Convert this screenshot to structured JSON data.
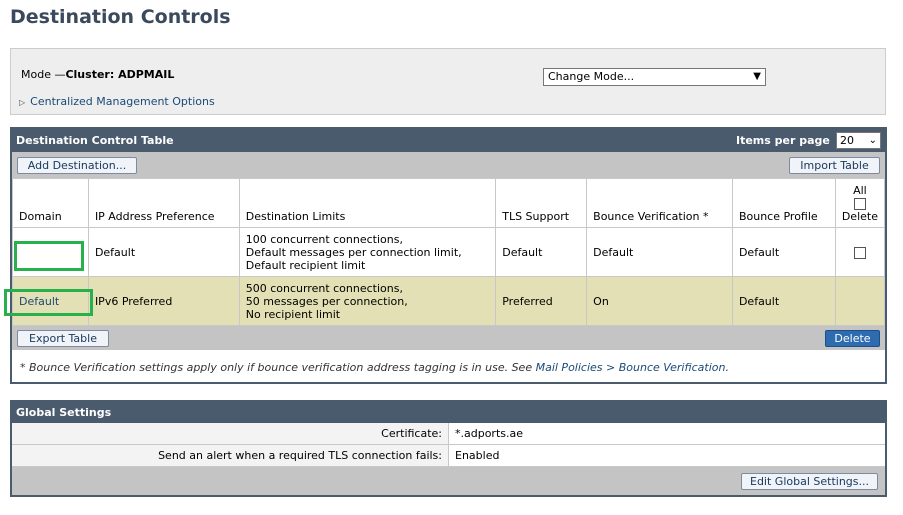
{
  "page": {
    "title": "Destination Controls"
  },
  "mode": {
    "prefix": "Mode —",
    "cluster": "Cluster: ADPMAIL",
    "select_value": "Change Mode...",
    "cm_options": "Centralized Management Options"
  },
  "dct": {
    "title": "Destination Control Table",
    "items_per_page_label": "Items per page",
    "items_per_page_value": "20",
    "add_button": "Add Destination...",
    "import_button": "Import Table",
    "export_button": "Export Table",
    "delete_button": "Delete",
    "columns": {
      "domain": "Domain",
      "ip_pref": "IP Address Preference",
      "limits": "Destination Limits",
      "tls": "TLS Support",
      "bounce_verif": "Bounce Verification *",
      "bounce_profile": "Bounce Profile",
      "delete_all": "All",
      "delete": "Delete"
    },
    "rows": [
      {
        "domain": "",
        "ip_pref": "Default",
        "limits": [
          "100 concurrent connections,",
          "Default messages per connection limit,",
          "Default recipient limit"
        ],
        "tls": "Default",
        "bounce_verif": "Default",
        "bounce_profile": "Default"
      },
      {
        "domain": "Default",
        "ip_pref": "IPv6 Preferred",
        "limits": [
          "500 concurrent connections,",
          "50 messages per connection,",
          "No recipient limit"
        ],
        "tls": "Preferred",
        "bounce_verif": "On",
        "bounce_profile": "Default"
      }
    ],
    "footnote_text": "* Bounce Verification settings apply only if bounce verification address tagging is in use. See ",
    "footnote_link": "Mail Policies > Bounce Verification",
    "footnote_end": "."
  },
  "global": {
    "title": "Global Settings",
    "certificate_label": "Certificate:",
    "certificate_value": "*.adports.ae",
    "alert_label": "Send an alert when a required TLS connection fails:",
    "alert_value": "Enabled",
    "edit_button": "Edit Global Settings..."
  },
  "colors": {
    "header_bar": "#4a5b6e",
    "default_row": "#e2e0b4",
    "highlight_box": "#27b04b",
    "title": "#3a4a5c"
  }
}
